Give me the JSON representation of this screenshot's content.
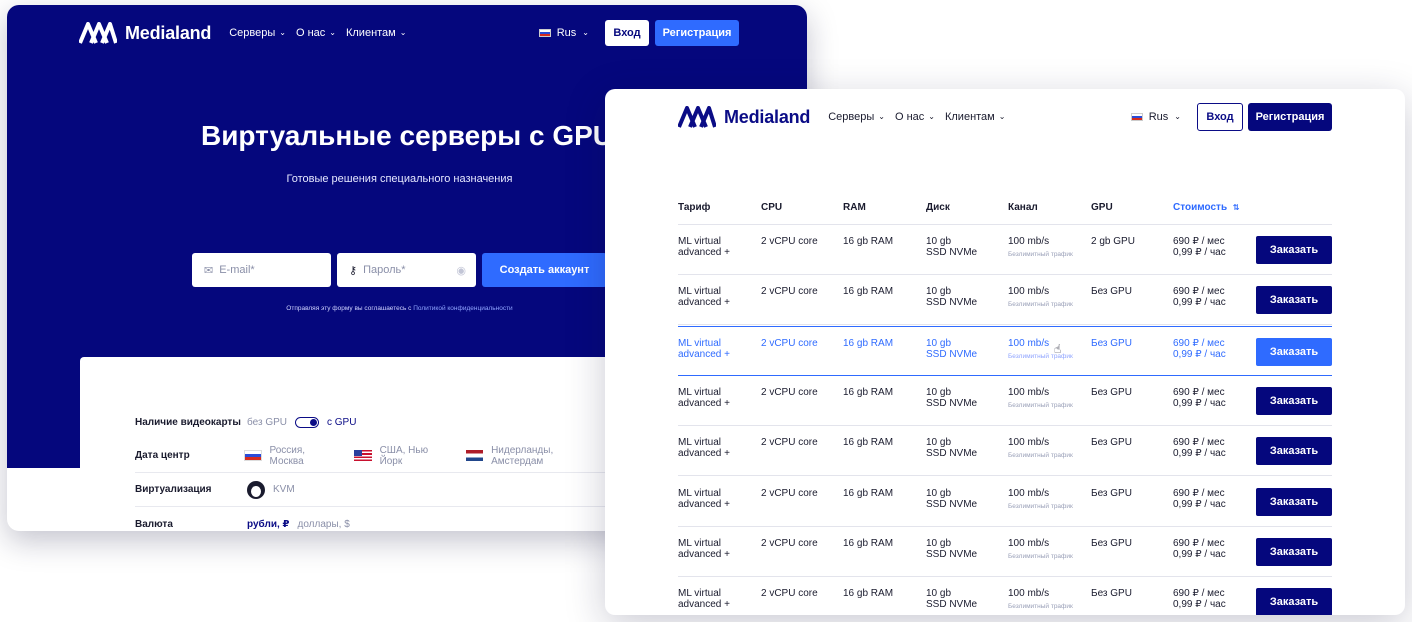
{
  "brand": {
    "name": "Medialand"
  },
  "nav": {
    "menu": [
      "Серверы",
      "О нас",
      "Клиентам"
    ],
    "lang": "Rus",
    "login": "Вход",
    "register": "Регистрация"
  },
  "hero": {
    "title": "Виртуальные серверы с GPU",
    "subtitle": "Готовые решения специального назначения",
    "email_placeholder": "E-mail*",
    "password_placeholder": "Пароль*",
    "create_account": "Создать аккаунт",
    "consent_text": "Отправляя эту форму вы соглашаетесь с",
    "consent_link": "Политикой конфиденциальности"
  },
  "filters": {
    "gpu": {
      "label": "Наличие видеокарты",
      "off": "без GPU",
      "on": "с GPU"
    },
    "datacenter": {
      "label": "Дата центр",
      "options": [
        "Россия, Москва",
        "США, Нью Йорк",
        "Нидерланды, Амстердам"
      ]
    },
    "virtualization": {
      "label": "Виртуализация",
      "value": "KVM"
    },
    "currency": {
      "label": "Валюта",
      "active": "рубли, ₽",
      "other": "доллары, $"
    }
  },
  "table": {
    "headers": [
      "Тариф",
      "CPU",
      "RAM",
      "Диск",
      "Канал",
      "GPU",
      "Стоимость"
    ],
    "order_label": "Заказать",
    "rows": [
      {
        "tariff1": "ML virtual",
        "tariff2": "advanced +",
        "cpu": "2 vCPU core",
        "ram": "16 gb RAM",
        "disk1": "10 gb",
        "disk2": "SSD NVMe",
        "channel": "100 mb/s",
        "traffic": "Безлимитный трафик",
        "gpu": "2 gb GPU",
        "price1": "690 ₽ / мес",
        "price2": "0,99 ₽ / час"
      },
      {
        "tariff1": "ML virtual",
        "tariff2": "advanced +",
        "cpu": "2 vCPU core",
        "ram": "16 gb RAM",
        "disk1": "10 gb",
        "disk2": "SSD NVMe",
        "channel": "100 mb/s",
        "traffic": "Безлимитный трафик",
        "gpu": "Без GPU",
        "price1": "690 ₽ / мес",
        "price2": "0,99 ₽ / час"
      },
      {
        "tariff1": "ML virtual",
        "tariff2": "advanced +",
        "cpu": "2 vCPU core",
        "ram": "16 gb RAM",
        "disk1": "10 gb",
        "disk2": "SSD NVMe",
        "channel": "100 mb/s",
        "traffic": "Безлимитный трафик",
        "gpu": "Без GPU",
        "price1": "690 ₽ / мес",
        "price2": "0,99 ₽ / час"
      },
      {
        "tariff1": "ML virtual",
        "tariff2": "advanced +",
        "cpu": "2 vCPU core",
        "ram": "16 gb RAM",
        "disk1": "10 gb",
        "disk2": "SSD NVMe",
        "channel": "100 mb/s",
        "traffic": "Безлимитный трафик",
        "gpu": "Без GPU",
        "price1": "690 ₽ / мес",
        "price2": "0,99 ₽ / час"
      },
      {
        "tariff1": "ML virtual",
        "tariff2": "advanced +",
        "cpu": "2 vCPU core",
        "ram": "16 gb RAM",
        "disk1": "10 gb",
        "disk2": "SSD NVMe",
        "channel": "100 mb/s",
        "traffic": "Безлимитный трафик",
        "gpu": "Без GPU",
        "price1": "690 ₽ / мес",
        "price2": "0,99 ₽ / час"
      },
      {
        "tariff1": "ML virtual",
        "tariff2": "advanced +",
        "cpu": "2 vCPU core",
        "ram": "16 gb RAM",
        "disk1": "10 gb",
        "disk2": "SSD NVMe",
        "channel": "100 mb/s",
        "traffic": "Безлимитный трафик",
        "gpu": "Без GPU",
        "price1": "690 ₽ / мес",
        "price2": "0,99 ₽ / час"
      },
      {
        "tariff1": "ML virtual",
        "tariff2": "advanced +",
        "cpu": "2 vCPU core",
        "ram": "16 gb RAM",
        "disk1": "10 gb",
        "disk2": "SSD NVMe",
        "channel": "100 mb/s",
        "traffic": "Безлимитный трафик",
        "gpu": "Без GPU",
        "price1": "690 ₽ / мес",
        "price2": "0,99 ₽ / час"
      },
      {
        "tariff1": "ML virtual",
        "tariff2": "advanced +",
        "cpu": "2 vCPU core",
        "ram": "16 gb RAM",
        "disk1": "10 gb",
        "disk2": "SSD NVMe",
        "channel": "100 mb/s",
        "traffic": "Безлимитный трафик",
        "gpu": "Без GPU",
        "price1": "690 ₽ / мес",
        "price2": "0,99 ₽ / час"
      }
    ]
  },
  "colors": {
    "brand_navy": "#05077d",
    "accent_blue": "#2f6bff"
  }
}
